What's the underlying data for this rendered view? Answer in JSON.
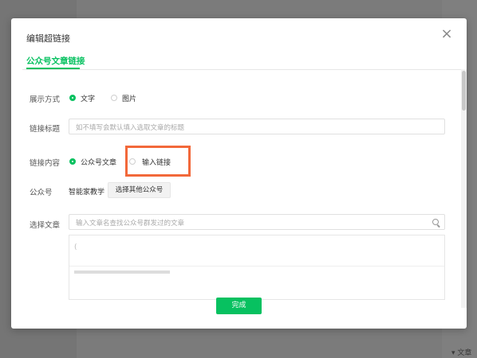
{
  "dialog": {
    "title": "编辑超链接",
    "tab": "公众号文章链接",
    "close": "×"
  },
  "display_mode": {
    "label": "展示方式",
    "options": [
      "文字",
      "图片"
    ],
    "selected": "文字"
  },
  "link_title": {
    "label": "链接标题",
    "placeholder": "如不填写会默认填入选取文章的标题"
  },
  "link_content": {
    "label": "链接内容",
    "options": [
      "公众号文章",
      "输入链接"
    ],
    "selected": "公众号文章"
  },
  "account": {
    "label": "公众号",
    "name": "智能家教学",
    "choose_other": "选择其他公众号"
  },
  "select_article": {
    "label": "选择文章",
    "placeholder": "输入文章名查找公众号群发过的文章"
  },
  "footer": {
    "done": "完成"
  },
  "background": {
    "corner_text": "▾ 文章"
  },
  "colors": {
    "accent": "#07c160",
    "highlight": "#f2683a"
  }
}
